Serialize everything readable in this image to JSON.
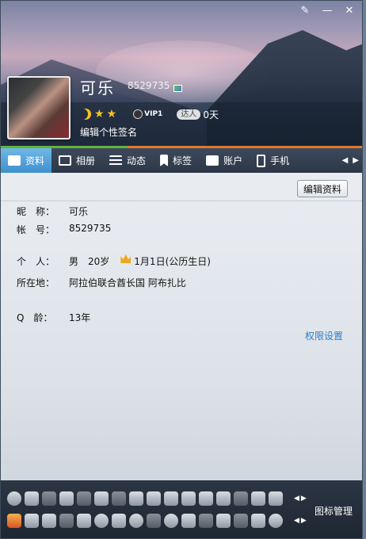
{
  "header": {
    "nickname": "可乐",
    "qq_number": "8529735",
    "vip_label": "VIP1",
    "daren_label": "达人",
    "days": "0天",
    "signature_placeholder": "编辑个性签名"
  },
  "window_controls": {
    "skin": "skin-icon",
    "minimize": "—",
    "close": "✕"
  },
  "tabs": [
    {
      "label": "资料",
      "icon": "profile-card-icon",
      "active": true
    },
    {
      "label": "相册",
      "icon": "photo-icon",
      "active": false
    },
    {
      "label": "动态",
      "icon": "feed-list-icon",
      "active": false
    },
    {
      "label": "标签",
      "icon": "tag-icon",
      "active": false
    },
    {
      "label": "账户",
      "icon": "wallet-icon",
      "active": false
    },
    {
      "label": "手机",
      "icon": "phone-icon",
      "active": false
    }
  ],
  "tab_nav": {
    "prev": "◀",
    "next": "▶"
  },
  "profile": {
    "edit_button": "编辑资料",
    "nickname_label": "昵　称：",
    "nickname_value": "可乐",
    "account_label": "帐　号：",
    "account_value": "8529735",
    "personal_label": "个　人：",
    "gender": "男",
    "age": "20岁",
    "birthday": "1月1日(公历生日)",
    "location_label": "所在地：",
    "location_value": "阿拉伯联合酋长国 阿布扎比",
    "qage_label": "Q　龄：",
    "qage_value": "13年",
    "permission_link": "权限设置"
  },
  "bottom": {
    "manage_label": "图标管理",
    "nav_prev": "◀",
    "nav_next": "▶"
  }
}
